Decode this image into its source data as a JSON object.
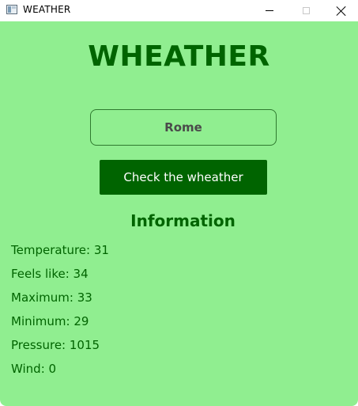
{
  "window": {
    "title": "WEATHER",
    "icon": "app-window-icon",
    "controls": [
      "minimize-icon",
      "maximize-icon",
      "close-icon"
    ]
  },
  "app": {
    "heading": "WHEATHER",
    "city_input": {
      "value": "Rome"
    },
    "check_button": "Check the wheather",
    "info_heading": "Information",
    "info": [
      {
        "label": "Temperature",
        "value": "31",
        "text": "Temperature: 31"
      },
      {
        "label": "Feels like",
        "value": "34",
        "text": "Feels like: 34"
      },
      {
        "label": "Maximum",
        "value": "33",
        "text": "Maximum: 33"
      },
      {
        "label": "Minimum",
        "value": "29",
        "text": "Minimum: 29"
      },
      {
        "label": "Pressure",
        "value": "1015",
        "text": "Pressure: 1015"
      },
      {
        "label": "Wind",
        "value": "0",
        "text": "Wind: 0"
      }
    ]
  },
  "colors": {
    "background": "#90ee90",
    "accent": "#006400",
    "button_text": "#ffffff",
    "input_text": "#4a4a4a"
  }
}
